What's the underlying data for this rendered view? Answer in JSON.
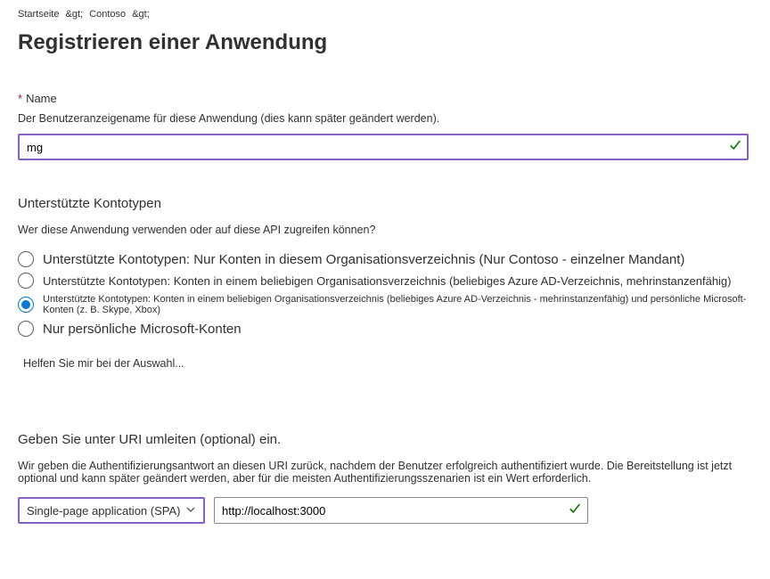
{
  "breadcrumb": {
    "home": "Startseite",
    "org": "Contoso",
    "sep": "&gt;"
  },
  "pageTitle": "Registrieren einer Anwendung",
  "nameField": {
    "label": "Name",
    "description": "Der Benutzeranzeigename für diese Anwendung (dies kann später geändert werden).",
    "value": "mg"
  },
  "accountTypes": {
    "heading": "Unterstützte Kontotypen",
    "subtext": "Wer diese Anwendung verwenden oder auf diese API zugreifen können?",
    "options": [
      "Unterstützte Kontotypen: Nur Konten in diesem Organisationsverzeichnis (Nur Contoso - einzelner Mandant)",
      "Unterstützte Kontotypen: Konten in einem beliebigen Organisationsverzeichnis (beliebiges Azure AD-Verzeichnis, mehrinstanzenfähig)",
      "Unterstützte Kontotypen: Konten in einem beliebigen Organisationsverzeichnis (beliebiges Azure AD-Verzeichnis - mehrinstanzenfähig) und persönliche Microsoft-Konten (z. B. Skype, Xbox)",
      "Nur persönliche Microsoft-Konten"
    ],
    "selectedIndex": 2,
    "helpLink": "Helfen Sie mir bei der Auswahl..."
  },
  "redirectUri": {
    "heading": "Geben Sie unter URI umleiten (optional) ein.",
    "description": "Wir geben die Authentifizierungsantwort an diesen URI zurück, nachdem der Benutzer erfolgreich authentifiziert wurde. Die Bereitstellung ist jetzt optional und kann später geändert werden, aber für die meisten Authentifizierungsszenarien ist ein Wert erforderlich.",
    "platform": "Single-page application (SPA)",
    "uri": "http://localhost:3000"
  }
}
